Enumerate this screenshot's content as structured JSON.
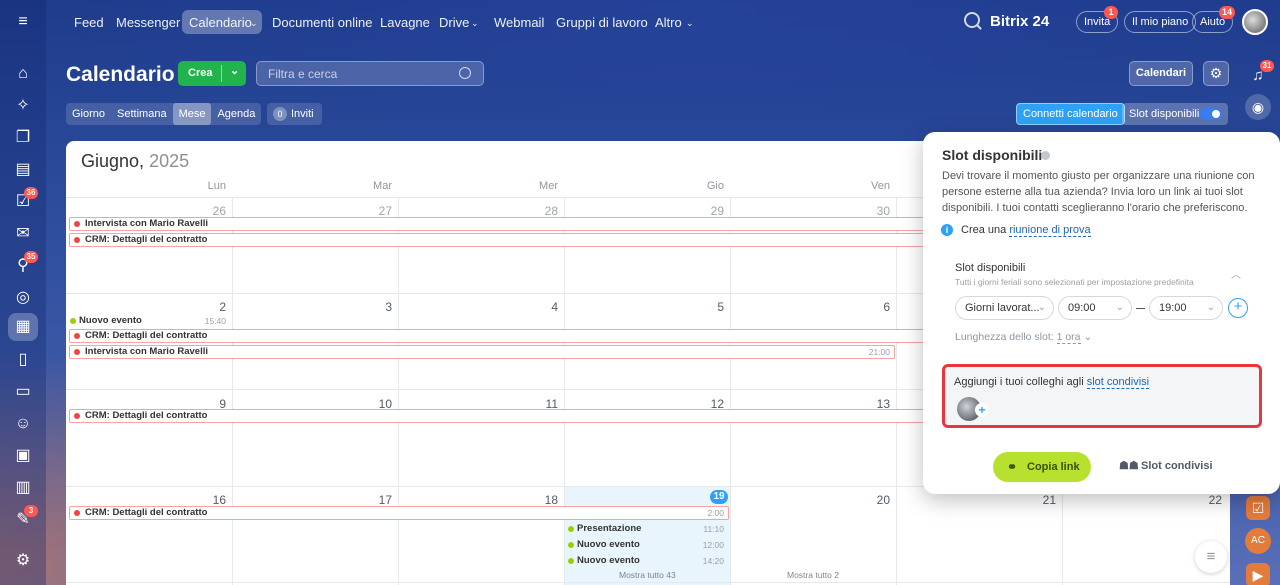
{
  "topnav": {
    "items": [
      "Feed",
      "Messenger",
      "Calendario",
      "Documenti online",
      "Lavagne",
      "Drive",
      "Webmail",
      "Gruppi di lavoro",
      "Altro"
    ],
    "logo": "Bitrix 24",
    "invita": "Invita",
    "invita_badge": "1",
    "piano": "Il mio piano",
    "aiuto": "Aiuto",
    "aiuto_badge": "14"
  },
  "leftbar": {
    "badges": {
      "tasks": "36",
      "feed": "35",
      "workflows": "3"
    }
  },
  "rightbar": {
    "notif_badge": "31",
    "ac_label": "AC"
  },
  "header": {
    "title": "Calendario",
    "crea": "Crea",
    "filter_placeholder": "Filtra e cerca",
    "calendari": "Calendari"
  },
  "views": [
    "Giorno",
    "Settimana",
    "Mese",
    "Agenda"
  ],
  "inviti": {
    "count": "0",
    "label": "Inviti"
  },
  "connetti": "Connetti calendario",
  "slot_button": "Slot disponibili",
  "calendar": {
    "month": "Giugno,",
    "year": "2025",
    "days": [
      "Lun",
      "Mar",
      "Mer",
      "Gio",
      "Ven"
    ],
    "weeks": [
      [
        "26",
        "27",
        "28",
        "29",
        "30"
      ],
      [
        "2",
        "3",
        "4",
        "5",
        "6"
      ],
      [
        "9",
        "10",
        "11",
        "12",
        "13"
      ],
      [
        "16",
        "17",
        "18",
        "19",
        "20",
        "21",
        "22"
      ]
    ],
    "events": {
      "e1": "Intervista con Mario Ravelli",
      "e2": "CRM: Dettagli del contratto",
      "e3": "Nuovo evento",
      "e3t": "15:40",
      "e4": "CRM: Dettagli del contratto",
      "e5": "Intervista con Mario Ravelli",
      "e5t": "21:00",
      "e6": "CRM: Dettagli del contratto",
      "e7": "CRM: Dettagli del contratto",
      "e7t": "2:00",
      "s1": "Presentazione",
      "s1t": "11:10",
      "s2": "Nuovo evento",
      "s2t": "12:00",
      "s3": "Nuovo evento",
      "s3t": "14:20",
      "more1": "Mostra tutto 43",
      "more2": "Mostra tutto 2"
    }
  },
  "popup": {
    "title": "Slot disponibili",
    "desc": "Devi trovare il momento giusto per organizzare una riunione con persone esterne alla tua azienda? Invia loro un link ai tuoi slot disponibili. I tuoi contatti sceglieranno l'orario che preferiscono.",
    "crea_una": "Crea una",
    "prova_link": "riunione di prova",
    "section_title": "Slot disponibili",
    "section_sub": "Tutti i giorni feriali sono selezionati per impostazione predefinita",
    "days_select": "Giorni lavorat...",
    "from": "09:00",
    "to": "19:00",
    "length_label": "Lunghezza dello slot:",
    "length_value": "1 ora",
    "colleghi": "Aggiungi i tuoi colleghi agli",
    "colleghi_link": "slot condivisi",
    "copy": "Copia link",
    "shared": "Slot condivisi"
  }
}
